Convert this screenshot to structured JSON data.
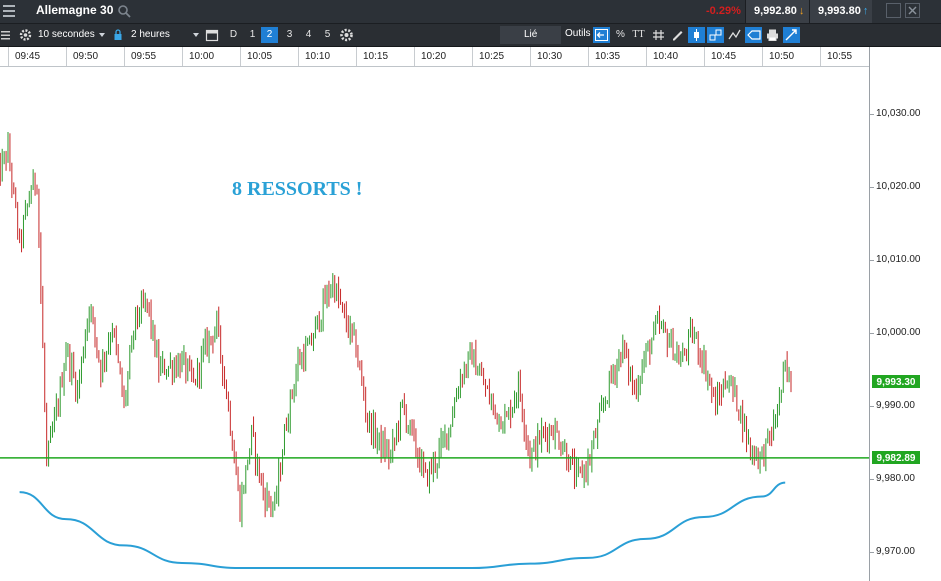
{
  "window": {
    "instrument": "Allemagne 30",
    "change_pct": "-0.29%",
    "bid": "9,992.80",
    "ask": "9,993.80",
    "bid_dir": "down",
    "ask_dir": "up"
  },
  "toolbar": {
    "interval": "10 secondes",
    "range": "2 heures",
    "day_label": "D",
    "layouts": [
      "1",
      "2",
      "3",
      "4",
      "5"
    ],
    "active_layout": "2",
    "linked": "Lié",
    "tools_label": "Outils",
    "percent_label": "%",
    "text_tool_label": "TT"
  },
  "colors": {
    "up_candle": "#2e9a2e",
    "down_candle": "#c62828",
    "price_badge": "#21a621",
    "support_line": "#1fa81f",
    "curve": "#2a9fd6",
    "annotation": "#2aa1d6",
    "titlebar": "#2c3137",
    "toolbar": "#2a2e33",
    "highlight": "#1f7fd4"
  },
  "chart_data": {
    "type": "candlestick",
    "timeframe": "10 secondes",
    "x_ticks": [
      "09:45",
      "09:50",
      "09:55",
      "10:00",
      "10:05",
      "10:10",
      "10:15",
      "10:20",
      "10:25",
      "10:30",
      "10:35",
      "10:40",
      "10:45",
      "10:50",
      "10:55"
    ],
    "y_ticks": [
      "10,030.00",
      "10,020.00",
      "10,010.00",
      "10,000.00",
      "9,990.00",
      "9,980.00",
      "9,970.00"
    ],
    "y_tick_values": [
      10030,
      10020,
      10010,
      10000,
      9990,
      9980,
      9970
    ],
    "ylim": [
      9966,
      10037
    ],
    "last_price_label": "9,993.30",
    "last_price": 9993.3,
    "support_label": "9,982.89",
    "support": 9982.89,
    "annotation": "8 RESSORTS !",
    "price_path": [
      {
        "t": "09:44",
        "p": 10021
      },
      {
        "t": "09:45",
        "p": 10025
      },
      {
        "t": "09:46",
        "p": 10012
      },
      {
        "t": "09:47",
        "p": 10020
      },
      {
        "t": "09:47:30",
        "p": 10021
      },
      {
        "t": "09:48:20",
        "p": 9982
      },
      {
        "t": "09:48:40",
        "p": 9985
      },
      {
        "t": "09:49:30",
        "p": 9992
      },
      {
        "t": "09:50",
        "p": 9998
      },
      {
        "t": "09:51",
        "p": 9992
      },
      {
        "t": "09:52",
        "p": 10004
      },
      {
        "t": "09:53",
        "p": 9995
      },
      {
        "t": "09:54",
        "p": 10001
      },
      {
        "t": "09:55",
        "p": 9990
      },
      {
        "t": "09:56",
        "p": 10002
      },
      {
        "t": "09:57",
        "p": 10004
      },
      {
        "t": "09:58",
        "p": 9995
      },
      {
        "t": "10:00",
        "p": 9996
      },
      {
        "t": "10:01",
        "p": 9993
      },
      {
        "t": "10:02",
        "p": 9998
      },
      {
        "t": "10:03",
        "p": 10001
      },
      {
        "t": "10:04",
        "p": 9990
      },
      {
        "t": "10:05",
        "p": 9976
      },
      {
        "t": "10:06",
        "p": 9986
      },
      {
        "t": "10:07",
        "p": 9978
      },
      {
        "t": "10:08",
        "p": 9976
      },
      {
        "t": "10:09",
        "p": 9988
      },
      {
        "t": "10:10",
        "p": 9996
      },
      {
        "t": "10:11",
        "p": 9998
      },
      {
        "t": "10:12",
        "p": 10003
      },
      {
        "t": "10:13",
        "p": 10007
      },
      {
        "t": "10:14",
        "p": 10002
      },
      {
        "t": "10:15",
        "p": 9998
      },
      {
        "t": "10:16",
        "p": 9988
      },
      {
        "t": "10:17",
        "p": 9985
      },
      {
        "t": "10:18",
        "p": 9983
      },
      {
        "t": "10:19",
        "p": 9990
      },
      {
        "t": "10:20",
        "p": 9985
      },
      {
        "t": "10:21",
        "p": 9980
      },
      {
        "t": "10:22",
        "p": 9983
      },
      {
        "t": "10:23",
        "p": 9987
      },
      {
        "t": "10:24",
        "p": 9994
      },
      {
        "t": "10:25",
        "p": 9997
      },
      {
        "t": "10:26",
        "p": 9993
      },
      {
        "t": "10:27",
        "p": 9989
      },
      {
        "t": "10:28",
        "p": 9988
      },
      {
        "t": "10:29",
        "p": 9993
      },
      {
        "t": "10:30",
        "p": 9983
      },
      {
        "t": "10:31",
        "p": 9986
      },
      {
        "t": "10:32",
        "p": 9987
      },
      {
        "t": "10:33",
        "p": 9984
      },
      {
        "t": "10:34",
        "p": 9980
      },
      {
        "t": "10:35",
        "p": 9982
      },
      {
        "t": "10:36",
        "p": 9988
      },
      {
        "t": "10:37",
        "p": 9994
      },
      {
        "t": "10:38",
        "p": 9998
      },
      {
        "t": "10:39",
        "p": 9992
      },
      {
        "t": "10:40",
        "p": 9997
      },
      {
        "t": "10:41",
        "p": 10001
      },
      {
        "t": "10:42",
        "p": 9999
      },
      {
        "t": "10:43",
        "p": 9996
      },
      {
        "t": "10:44",
        "p": 10000
      },
      {
        "t": "10:45",
        "p": 9996
      },
      {
        "t": "10:46",
        "p": 9990
      },
      {
        "t": "10:47",
        "p": 9994
      },
      {
        "t": "10:48",
        "p": 9990
      },
      {
        "t": "10:49",
        "p": 9984
      },
      {
        "t": "10:50",
        "p": 9983
      },
      {
        "t": "10:51",
        "p": 9987
      },
      {
        "t": "10:52",
        "p": 9995
      },
      {
        "t": "10:52:30",
        "p": 9993
      }
    ],
    "curve_series": [
      {
        "t": "09:46",
        "v": 9978.2
      },
      {
        "t": "09:50",
        "v": 9974.5
      },
      {
        "t": "09:55",
        "v": 9970.9
      },
      {
        "t": "10:00",
        "v": 9968.5
      },
      {
        "t": "10:05",
        "v": 9967.8
      },
      {
        "t": "10:10",
        "v": 9967.8
      },
      {
        "t": "10:15",
        "v": 9967.8
      },
      {
        "t": "10:20",
        "v": 9967.8
      },
      {
        "t": "10:25",
        "v": 9967.8
      },
      {
        "t": "10:30",
        "v": 9968.4
      },
      {
        "t": "10:35",
        "v": 9969.2
      },
      {
        "t": "10:40",
        "v": 9971.8
      },
      {
        "t": "10:45",
        "v": 9974.8
      },
      {
        "t": "10:50",
        "v": 9977.6
      },
      {
        "t": "10:52",
        "v": 9979.5
      }
    ]
  }
}
